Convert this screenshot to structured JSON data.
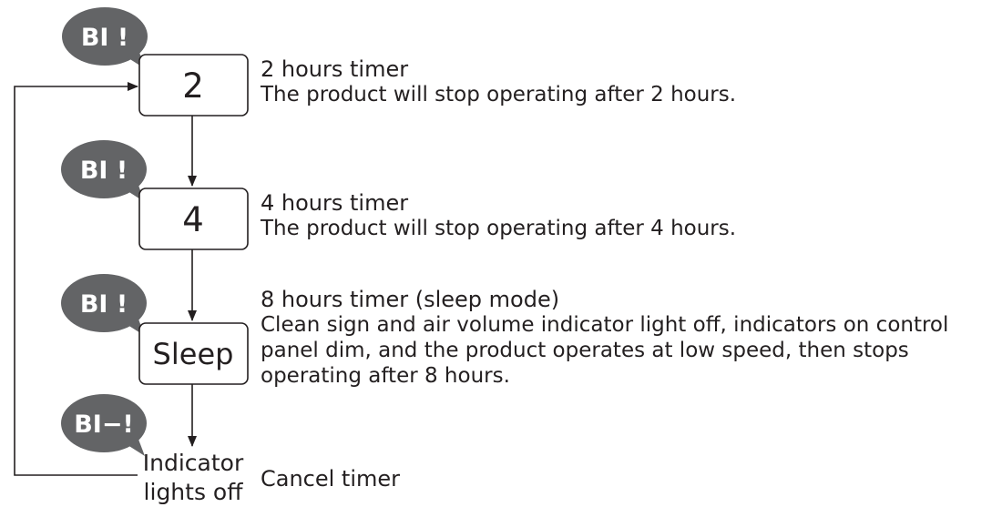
{
  "steps": [
    {
      "bubble": "BI !",
      "box_label": "2",
      "title": "2 hours timer",
      "description": "The product will stop operating after 2 hours."
    },
    {
      "bubble": "BI !",
      "box_label": "4",
      "title": "4 hours timer",
      "description": "The product will stop operating after 4 hours."
    },
    {
      "bubble": "BI !",
      "box_label": "Sleep",
      "title": "8 hours timer (sleep mode)",
      "description": "Clean sign and air volume indicator light off, indicators on control panel dim, and the product operates at low speed, then stops operating after 8 hours."
    },
    {
      "bubble": "BI−!",
      "indicator_line1": "Indicator",
      "indicator_line2": "lights off",
      "title": "Cancel timer"
    }
  ],
  "colors": {
    "bubble": "#636466",
    "line": "#231f20",
    "text": "#231f20"
  }
}
